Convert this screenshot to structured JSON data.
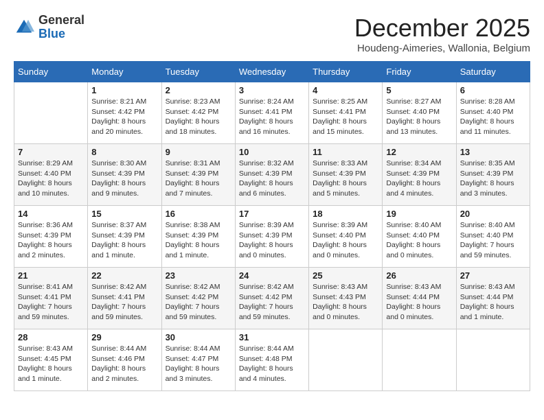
{
  "logo": {
    "general": "General",
    "blue": "Blue"
  },
  "header": {
    "month": "December 2025",
    "location": "Houdeng-Aimeries, Wallonia, Belgium"
  },
  "weekdays": [
    "Sunday",
    "Monday",
    "Tuesday",
    "Wednesday",
    "Thursday",
    "Friday",
    "Saturday"
  ],
  "weeks": [
    [
      {
        "day": "",
        "info": ""
      },
      {
        "day": "1",
        "info": "Sunrise: 8:21 AM\nSunset: 4:42 PM\nDaylight: 8 hours\nand 20 minutes."
      },
      {
        "day": "2",
        "info": "Sunrise: 8:23 AM\nSunset: 4:42 PM\nDaylight: 8 hours\nand 18 minutes."
      },
      {
        "day": "3",
        "info": "Sunrise: 8:24 AM\nSunset: 4:41 PM\nDaylight: 8 hours\nand 16 minutes."
      },
      {
        "day": "4",
        "info": "Sunrise: 8:25 AM\nSunset: 4:41 PM\nDaylight: 8 hours\nand 15 minutes."
      },
      {
        "day": "5",
        "info": "Sunrise: 8:27 AM\nSunset: 4:40 PM\nDaylight: 8 hours\nand 13 minutes."
      },
      {
        "day": "6",
        "info": "Sunrise: 8:28 AM\nSunset: 4:40 PM\nDaylight: 8 hours\nand 11 minutes."
      }
    ],
    [
      {
        "day": "7",
        "info": "Sunrise: 8:29 AM\nSunset: 4:40 PM\nDaylight: 8 hours\nand 10 minutes."
      },
      {
        "day": "8",
        "info": "Sunrise: 8:30 AM\nSunset: 4:39 PM\nDaylight: 8 hours\nand 9 minutes."
      },
      {
        "day": "9",
        "info": "Sunrise: 8:31 AM\nSunset: 4:39 PM\nDaylight: 8 hours\nand 7 minutes."
      },
      {
        "day": "10",
        "info": "Sunrise: 8:32 AM\nSunset: 4:39 PM\nDaylight: 8 hours\nand 6 minutes."
      },
      {
        "day": "11",
        "info": "Sunrise: 8:33 AM\nSunset: 4:39 PM\nDaylight: 8 hours\nand 5 minutes."
      },
      {
        "day": "12",
        "info": "Sunrise: 8:34 AM\nSunset: 4:39 PM\nDaylight: 8 hours\nand 4 minutes."
      },
      {
        "day": "13",
        "info": "Sunrise: 8:35 AM\nSunset: 4:39 PM\nDaylight: 8 hours\nand 3 minutes."
      }
    ],
    [
      {
        "day": "14",
        "info": "Sunrise: 8:36 AM\nSunset: 4:39 PM\nDaylight: 8 hours\nand 2 minutes."
      },
      {
        "day": "15",
        "info": "Sunrise: 8:37 AM\nSunset: 4:39 PM\nDaylight: 8 hours\nand 1 minute."
      },
      {
        "day": "16",
        "info": "Sunrise: 8:38 AM\nSunset: 4:39 PM\nDaylight: 8 hours\nand 1 minute."
      },
      {
        "day": "17",
        "info": "Sunrise: 8:39 AM\nSunset: 4:39 PM\nDaylight: 8 hours\nand 0 minutes."
      },
      {
        "day": "18",
        "info": "Sunrise: 8:39 AM\nSunset: 4:40 PM\nDaylight: 8 hours\nand 0 minutes."
      },
      {
        "day": "19",
        "info": "Sunrise: 8:40 AM\nSunset: 4:40 PM\nDaylight: 8 hours\nand 0 minutes."
      },
      {
        "day": "20",
        "info": "Sunrise: 8:40 AM\nSunset: 4:40 PM\nDaylight: 7 hours\nand 59 minutes."
      }
    ],
    [
      {
        "day": "21",
        "info": "Sunrise: 8:41 AM\nSunset: 4:41 PM\nDaylight: 7 hours\nand 59 minutes."
      },
      {
        "day": "22",
        "info": "Sunrise: 8:42 AM\nSunset: 4:41 PM\nDaylight: 7 hours\nand 59 minutes."
      },
      {
        "day": "23",
        "info": "Sunrise: 8:42 AM\nSunset: 4:42 PM\nDaylight: 7 hours\nand 59 minutes."
      },
      {
        "day": "24",
        "info": "Sunrise: 8:42 AM\nSunset: 4:42 PM\nDaylight: 7 hours\nand 59 minutes."
      },
      {
        "day": "25",
        "info": "Sunrise: 8:43 AM\nSunset: 4:43 PM\nDaylight: 8 hours\nand 0 minutes."
      },
      {
        "day": "26",
        "info": "Sunrise: 8:43 AM\nSunset: 4:44 PM\nDaylight: 8 hours\nand 0 minutes."
      },
      {
        "day": "27",
        "info": "Sunrise: 8:43 AM\nSunset: 4:44 PM\nDaylight: 8 hours\nand 1 minute."
      }
    ],
    [
      {
        "day": "28",
        "info": "Sunrise: 8:43 AM\nSunset: 4:45 PM\nDaylight: 8 hours\nand 1 minute."
      },
      {
        "day": "29",
        "info": "Sunrise: 8:44 AM\nSunset: 4:46 PM\nDaylight: 8 hours\nand 2 minutes."
      },
      {
        "day": "30",
        "info": "Sunrise: 8:44 AM\nSunset: 4:47 PM\nDaylight: 8 hours\nand 3 minutes."
      },
      {
        "day": "31",
        "info": "Sunrise: 8:44 AM\nSunset: 4:48 PM\nDaylight: 8 hours\nand 4 minutes."
      },
      {
        "day": "",
        "info": ""
      },
      {
        "day": "",
        "info": ""
      },
      {
        "day": "",
        "info": ""
      }
    ]
  ]
}
